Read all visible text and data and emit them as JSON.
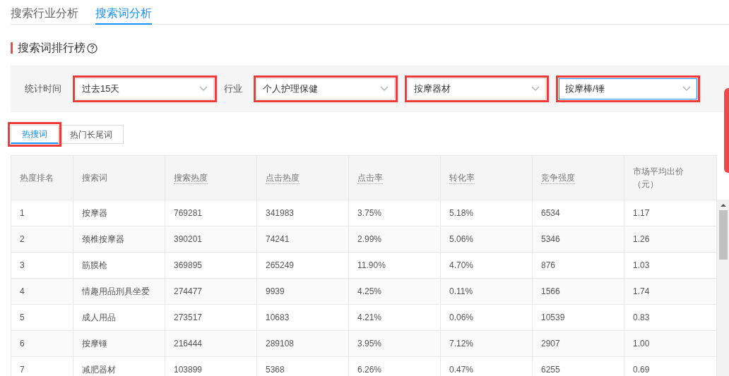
{
  "tabs": [
    {
      "label": "搜索行业分析",
      "selected": false
    },
    {
      "label": "搜索词分析",
      "selected": true
    }
  ],
  "section": {
    "title": "搜索词排行榜"
  },
  "filters": [
    {
      "label": "统计时间",
      "value": "过去15天",
      "highlighted": true,
      "focused": false
    },
    {
      "label": "行业",
      "value": "个人护理保健",
      "highlighted": true,
      "focused": false
    },
    {
      "value": "按摩器材",
      "highlighted": true,
      "focused": false
    },
    {
      "value": "按摩棒/锤",
      "highlighted": true,
      "focused": true
    }
  ],
  "word_tabs": [
    {
      "label": "热搜词",
      "selected": true,
      "highlighted": true
    },
    {
      "label": "热门长尾词",
      "selected": false,
      "highlighted": false
    }
  ],
  "table": {
    "columns": [
      {
        "label": "热度排名",
        "underlined": false
      },
      {
        "label": "搜索词",
        "underlined": false
      },
      {
        "label": "搜索热度",
        "underlined": true
      },
      {
        "label": "点击热度",
        "underlined": true
      },
      {
        "label": "点击率",
        "underlined": true
      },
      {
        "label": "转化率",
        "underlined": true
      },
      {
        "label": "竞争强度",
        "underlined": true
      },
      {
        "label": "市场平均出价（元）",
        "underlined": false
      }
    ],
    "rows": [
      [
        "1",
        "按摩器",
        "769281",
        "341983",
        "3.75%",
        "5.18%",
        "6534",
        "1.17"
      ],
      [
        "2",
        "颈椎按摩器",
        "390201",
        "74241",
        "2.99%",
        "5.06%",
        "5346",
        "1.26"
      ],
      [
        "3",
        "筋膜枪",
        "369895",
        "265249",
        "11.90%",
        "4.70%",
        "876",
        "1.03"
      ],
      [
        "4",
        "情趣用品刑具坐爱",
        "274477",
        "9939",
        "4.25%",
        "0.11%",
        "1566",
        "1.74"
      ],
      [
        "5",
        "成人用品",
        "273517",
        "10683",
        "4.21%",
        "0.06%",
        "10539",
        "0.83"
      ],
      [
        "6",
        "按摩锤",
        "216444",
        "289108",
        "3.95%",
        "7.12%",
        "2907",
        "1.00"
      ],
      [
        "7",
        "减肥器材",
        "103899",
        "5368",
        "6.26%",
        "0.47%",
        "6255",
        "0.69"
      ]
    ]
  }
}
